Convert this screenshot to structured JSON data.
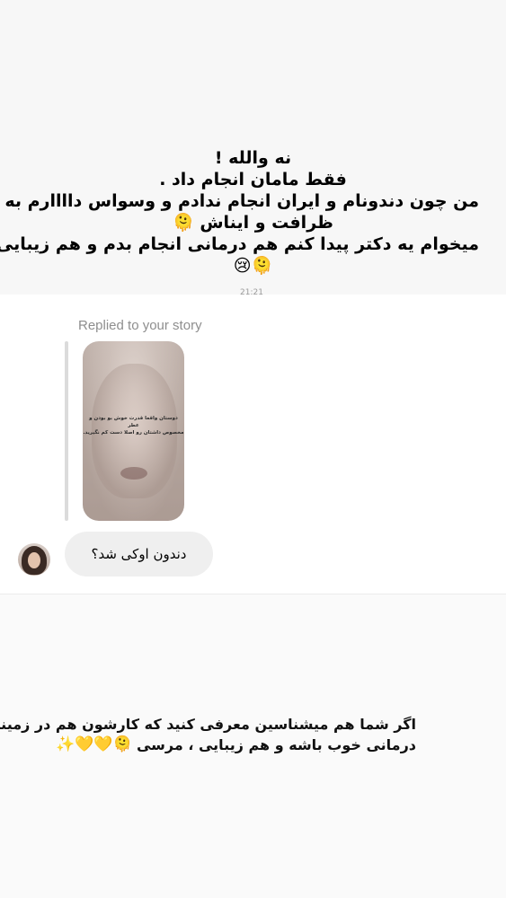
{
  "top_caption": {
    "lines": [
      "نه والله !",
      "فقط مامان انجام داد .",
      "من چون دندونام و ایران انجام ندادم و وسواس داااارم به",
      "ظرافت و ایناش 🫠",
      "میخوام یه دکتر پیدا کنم هم درمانی انجام بدم و هم زیبایی",
      "🫠😢"
    ]
  },
  "chat": {
    "timestamp_fragment": "21:21",
    "replied_label": "Replied to your story",
    "story_overlay_text": [
      "دوستان واقعا قدرت خوش بو بودن و عطر",
      "مخصوص داشتان رو اصلا دست کم نگیرید."
    ],
    "message_text": "دندون اوکی شد؟"
  },
  "bottom_caption": {
    "line1": "اگر شما هم میشناسین معرفی کنید که کارشون هم در زمینه",
    "line2": "درمانی خوب باشه و هم زیبایی ، مرسی",
    "emojis": "✨💛💛🫠"
  }
}
